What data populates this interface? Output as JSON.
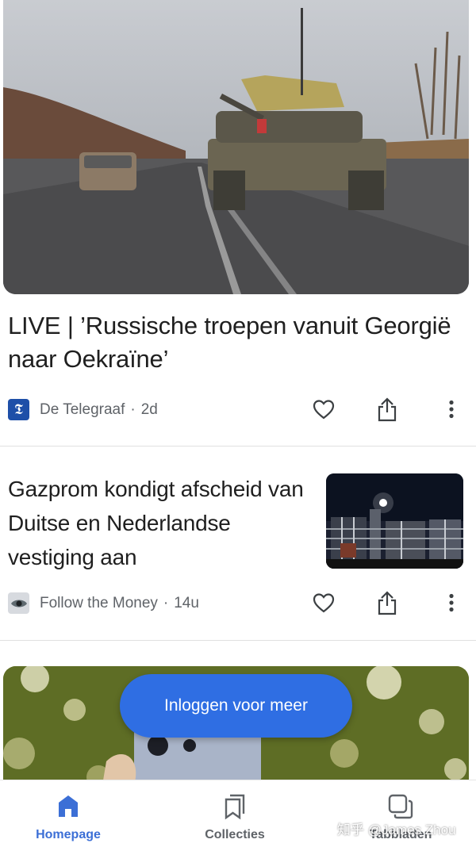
{
  "articles": [
    {
      "title": "LIVE | ’Russische troepen vanuit Georgië naar Oekraïne’",
      "source": "De Telegraaf",
      "age": "2d",
      "logo_glyph": "𝕿",
      "logo_color": "#1e4fa8"
    },
    {
      "title": "Gazprom kondigt afscheid van Duitse en Nederlandse vestiging aan",
      "source": "Follow the Money",
      "age": "14u"
    }
  ],
  "meta_separator": "·",
  "login_button": "Inloggen voor meer",
  "bottom_nav": [
    {
      "label": "Homepage",
      "icon": "home-icon",
      "active": true
    },
    {
      "label": "Collecties",
      "icon": "bookmarks-icon",
      "active": false
    },
    {
      "label": "Tabbladen",
      "icon": "tabs-icon",
      "active": false
    }
  ],
  "watermark": "知乎 @James Zhou",
  "colors": {
    "accent": "#2f6ee3",
    "active_nav": "#3c6fd6",
    "secondary_text": "#5f6368"
  }
}
